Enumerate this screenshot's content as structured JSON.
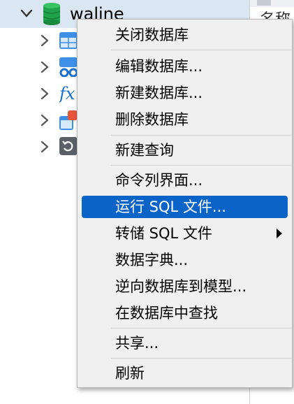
{
  "tree": {
    "database_name": "waline",
    "children": [
      {
        "icon": "tables-icon"
      },
      {
        "icon": "views-icon"
      },
      {
        "icon": "functions-icon"
      },
      {
        "icon": "queries-icon"
      },
      {
        "icon": "backups-icon"
      }
    ]
  },
  "right_pane": {
    "label": "名称"
  },
  "context_menu": {
    "items": [
      {
        "label": "关闭数据库"
      },
      {
        "label": "编辑数据库..."
      },
      {
        "label": "新建数据库..."
      },
      {
        "label": "删除数据库"
      },
      {
        "label": "新建查询"
      },
      {
        "label": "命令列界面..."
      },
      {
        "label": "运行 SQL 文件...",
        "highlighted": true
      },
      {
        "label": "转储 SQL 文件",
        "submenu": true
      },
      {
        "label": "数据字典..."
      },
      {
        "label": "逆向数据库到模型..."
      },
      {
        "label": "在数据库中查找"
      },
      {
        "label": "共享..."
      },
      {
        "label": "刷新"
      }
    ]
  },
  "colors": {
    "highlight": "#0a64c8",
    "selected_row": "#dbe6f3",
    "db_icon": "#1fa24a"
  }
}
